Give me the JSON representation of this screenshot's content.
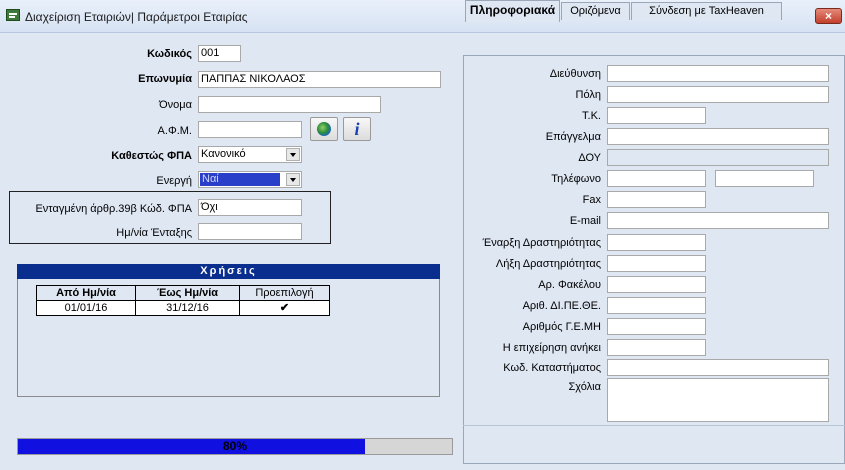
{
  "window": {
    "title": "Διαχείριση Εταιριών| Παράμετροι Εταιρίας",
    "close_label": "×"
  },
  "left": {
    "code": {
      "label": "Κωδικός",
      "value": "001"
    },
    "name": {
      "label": "Επωνυμία",
      "value": "ΠΑΠΠΑΣ ΝΙΚΟΛΑΟΣ"
    },
    "first_name": {
      "label": "Όνομα",
      "value": ""
    },
    "afm": {
      "label": "Α.Φ.Μ.",
      "value": ""
    },
    "vat_status": {
      "label": "Καθεστώς ΦΠΑ",
      "value": "Κανονικό"
    },
    "active": {
      "label": "Ενεργή",
      "value": "Ναί"
    },
    "art39": {
      "label": "Ενταγμένη άρθρ.39β Κώδ. ΦΠΑ",
      "value": "Όχι"
    },
    "join_date": {
      "label": "Ημ/νία Ένταξης",
      "value": ""
    }
  },
  "usages": {
    "header": "Χρήσεις",
    "columns": [
      "Από Ημ/νία",
      "Έως Ημ/νία",
      "Προεπιλογή"
    ],
    "rows": [
      {
        "from": "01/01/16",
        "to": "31/12/16",
        "default": "✔"
      }
    ]
  },
  "progress": {
    "percent": 80,
    "label": "80%"
  },
  "tabs": [
    {
      "label": "Πληροφοριακά",
      "active": true
    },
    {
      "label": "Οριζόμενα",
      "active": false
    },
    {
      "label": "Σύνδεση με TaxHeaven",
      "active": false
    }
  ],
  "info": {
    "address": {
      "label": "Διεύθυνση",
      "value": ""
    },
    "city": {
      "label": "Πόλη",
      "value": ""
    },
    "postal": {
      "label": "Τ.Κ.",
      "value": ""
    },
    "profession": {
      "label": "Επάγγελμα",
      "value": ""
    },
    "doy": {
      "label": "ΔΟΥ",
      "value": ""
    },
    "phone": {
      "label": "Τηλέφωνο",
      "value": "",
      "value2": ""
    },
    "fax": {
      "label": "Fax",
      "value": ""
    },
    "email": {
      "label": "E-mail",
      "value": ""
    },
    "start": {
      "label": "Έναρξη Δραστηριότητας",
      "value": ""
    },
    "end": {
      "label": "Λήξη Δραστηριότητας",
      "value": ""
    },
    "folder": {
      "label": "Αρ. Φακέλου",
      "value": ""
    },
    "dipethe": {
      "label": "Αριθ. ΔΙ.ΠΕ.ΘΕ.",
      "value": ""
    },
    "gemh": {
      "label": "Αριθμός Γ.Ε.ΜΗ",
      "value": ""
    },
    "belongs": {
      "label": "Η επιχείρηση ανήκει",
      "value": ""
    },
    "store_code": {
      "label": "Κωδ. Καταστήματος",
      "value": ""
    },
    "comments": {
      "label": "Σχόλια",
      "value": ""
    }
  }
}
